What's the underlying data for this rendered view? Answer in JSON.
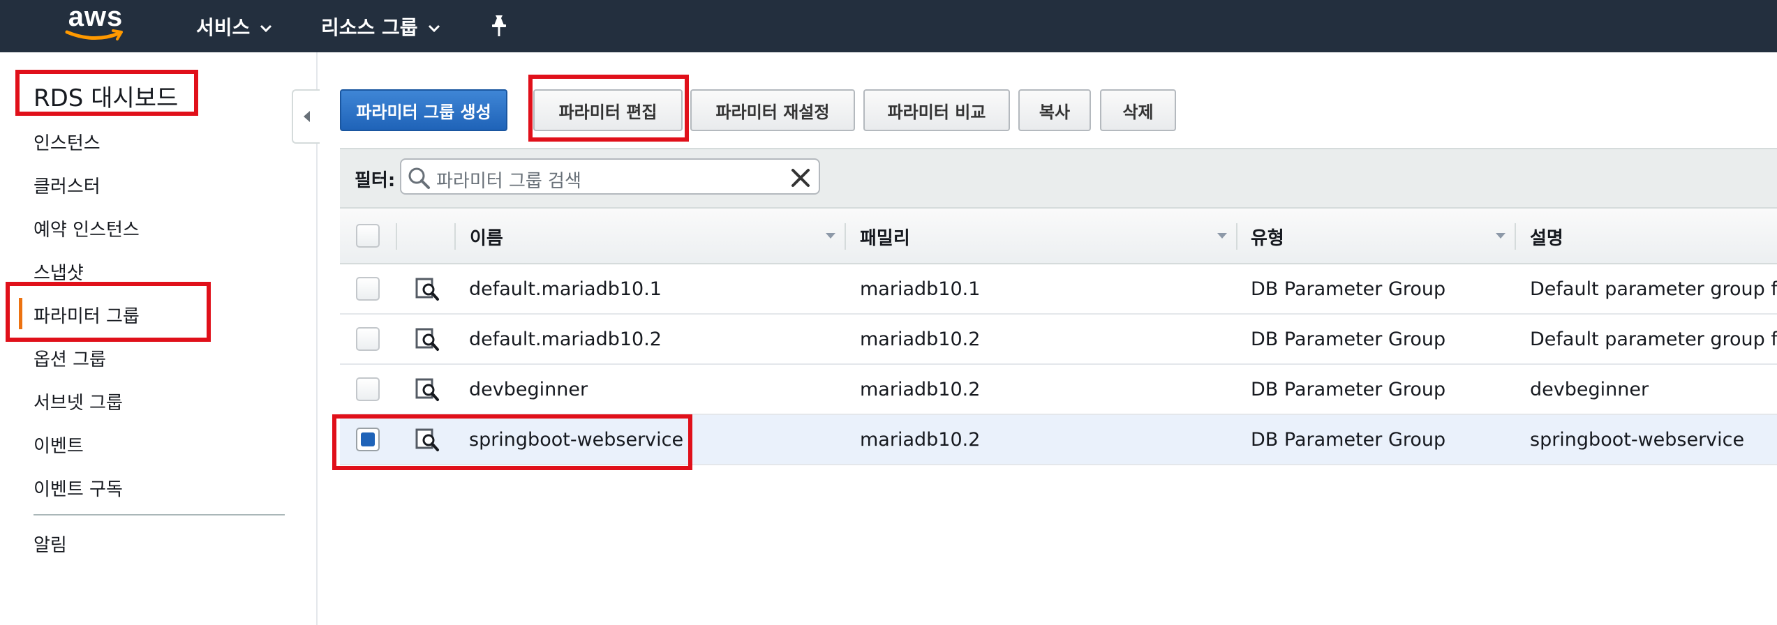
{
  "topnav": {
    "logo_text": "aws",
    "services_label": "서비스",
    "resource_groups_label": "리소스 그룹",
    "pin_icon": "pin-icon"
  },
  "sidebar": {
    "title": "RDS 대시보드",
    "items": [
      {
        "label": "인스턴스"
      },
      {
        "label": "클러스터"
      },
      {
        "label": "예약 인스턴스"
      },
      {
        "label": "스냅샷"
      },
      {
        "label": "파라미터 그룹",
        "active": true
      },
      {
        "label": "옵션 그룹"
      },
      {
        "label": "서브넷 그룹"
      },
      {
        "label": "이벤트"
      },
      {
        "label": "이벤트 구독"
      },
      {
        "label": "알림"
      }
    ]
  },
  "toolbar": {
    "create_label": "파라미터 그룹 생성",
    "edit_label": "파라미터 편집",
    "reset_label": "파라미터 재설정",
    "compare_label": "파라미터 비교",
    "copy_label": "복사",
    "delete_label": "삭제"
  },
  "filter": {
    "label": "필터:",
    "placeholder": "파라미터 그룹 검색"
  },
  "table": {
    "columns": [
      "이름",
      "패밀리",
      "유형",
      "설명"
    ],
    "rows": [
      {
        "name": "default.mariadb10.1",
        "family": "mariadb10.1",
        "type": "DB Parameter Group",
        "description": "Default parameter group for",
        "selected": false
      },
      {
        "name": "default.mariadb10.2",
        "family": "mariadb10.2",
        "type": "DB Parameter Group",
        "description": "Default parameter group for",
        "selected": false
      },
      {
        "name": "devbeginner",
        "family": "mariadb10.2",
        "type": "DB Parameter Group",
        "description": "devbeginner",
        "selected": false
      },
      {
        "name": "springboot-webservice",
        "family": "mariadb10.2",
        "type": "DB Parameter Group",
        "description": "springboot-webservice",
        "selected": true
      }
    ]
  },
  "colors": {
    "nav_bg": "#232f3e",
    "primary_button": "#1f63b8",
    "active_indicator": "#ec7211",
    "selected_row": "#eaf1fb",
    "highlight": "#e0101a"
  }
}
